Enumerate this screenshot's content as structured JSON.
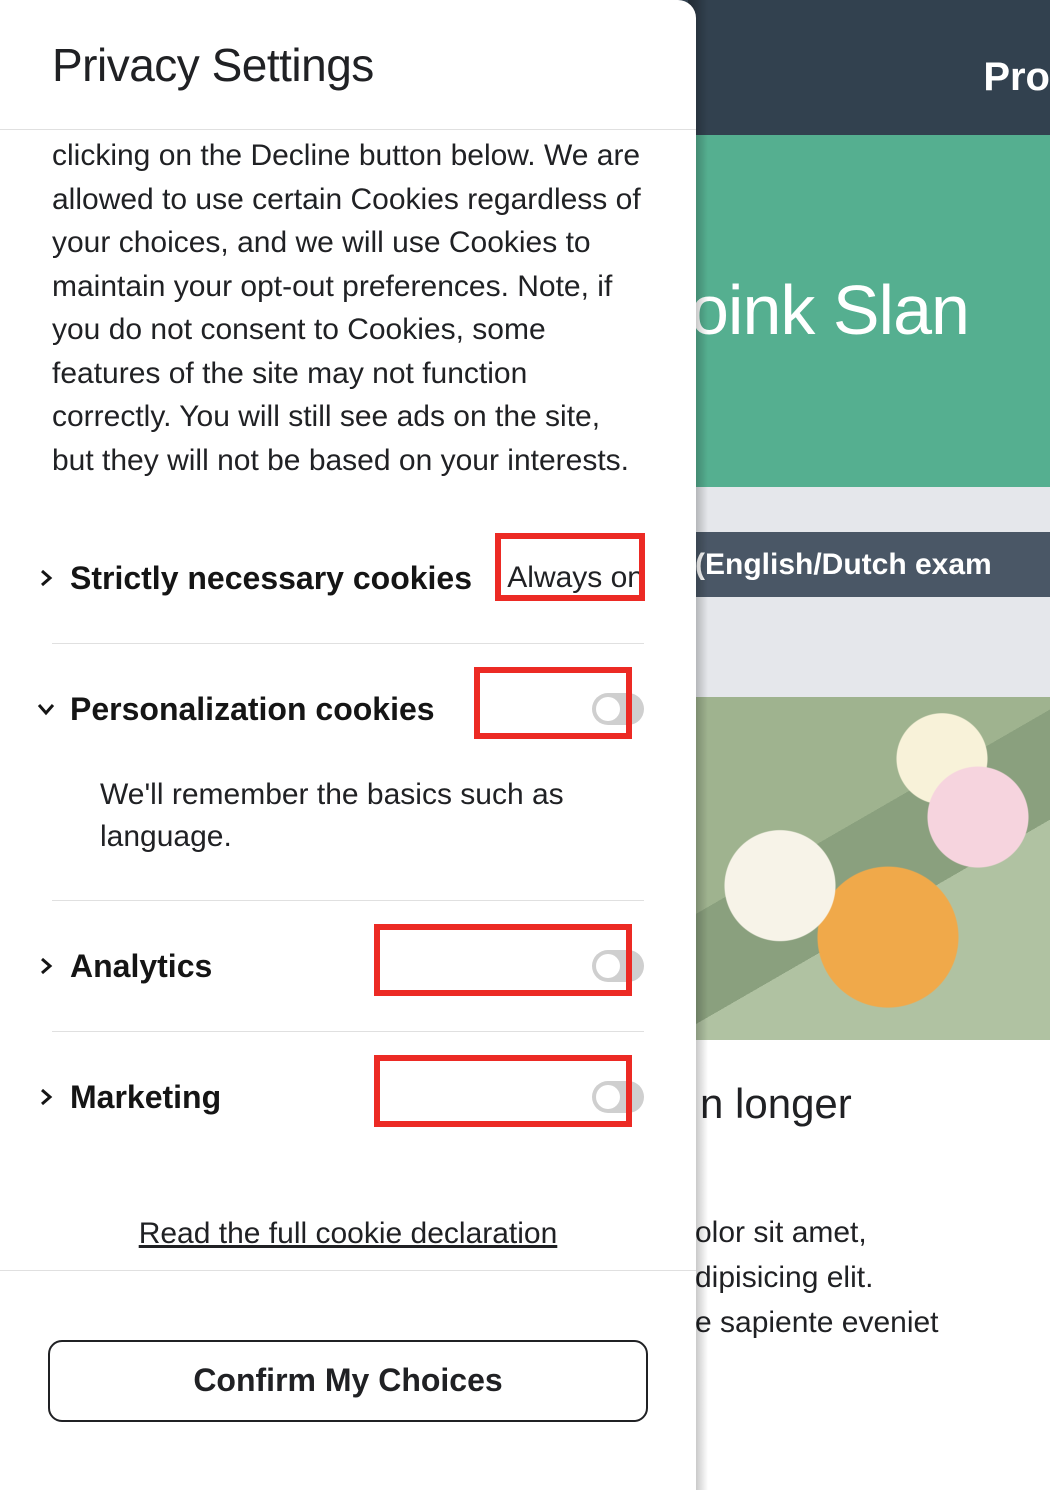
{
  "background": {
    "nav_label": "Pro",
    "hero_title": "oink Slan",
    "strip_label": "(English/Dutch exam",
    "article_heading_fragment": "n longer",
    "lorem_line1": "olor sit amet,",
    "lorem_line2": "dipisicing elit.",
    "lorem_line3": "e sapiente eveniet"
  },
  "modal": {
    "title": "Privacy Settings",
    "intro": "clicking on the Decline button below. We are allowed to use certain Cookies regardless of your choices, and we will use Cookies to maintain your opt-out preferences. Note, if you do not consent to Cookies, some features of the site may not function correctly. You will still see ads on the site, but they will not be based on your interests.",
    "categories": [
      {
        "name": "Strictly necessary cookies",
        "expanded": false,
        "type": "always_on",
        "always_on_label": "Always on"
      },
      {
        "name": "Personalization cookies",
        "expanded": true,
        "type": "toggle",
        "on": false,
        "description": "We'll remember the basics such as language."
      },
      {
        "name": "Analytics",
        "expanded": false,
        "type": "toggle",
        "on": false
      },
      {
        "name": "Marketing",
        "expanded": false,
        "type": "toggle",
        "on": false
      }
    ],
    "declaration_link": "Read the full cookie declaration",
    "confirm_button": "Confirm My Choices"
  },
  "highlight_color": "#ec2a24"
}
